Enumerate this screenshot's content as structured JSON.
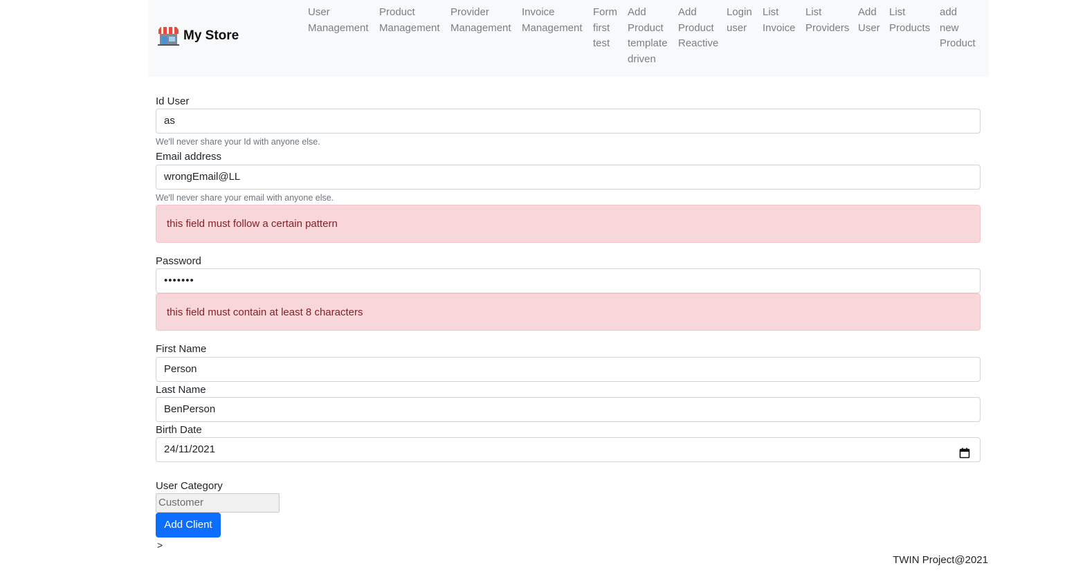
{
  "navbar": {
    "brand": "My Store",
    "brand_icon": "store-icon",
    "links": [
      {
        "id": "user-management",
        "lines": [
          "User",
          "Management"
        ]
      },
      {
        "id": "product-management",
        "lines": [
          "Product",
          "Management"
        ]
      },
      {
        "id": "provider-management",
        "lines": [
          "Provider",
          "Management"
        ]
      },
      {
        "id": "invoice-management",
        "lines": [
          "Invoice",
          "Management"
        ]
      },
      {
        "id": "form-first-test",
        "lines": [
          "Form",
          "first",
          "test"
        ]
      },
      {
        "id": "add-product-template-driven",
        "lines": [
          "Add",
          "Product",
          "template",
          "driven"
        ]
      },
      {
        "id": "add-product-reactive",
        "lines": [
          "Add",
          "Product",
          "Reactive"
        ]
      },
      {
        "id": "login-user",
        "lines": [
          "Login",
          "user"
        ]
      },
      {
        "id": "list-invoice",
        "lines": [
          "List",
          "Invoice"
        ]
      },
      {
        "id": "list-providers",
        "lines": [
          "List",
          "Providers"
        ]
      },
      {
        "id": "add-user",
        "lines": [
          "Add",
          "User"
        ]
      },
      {
        "id": "list-products",
        "lines": [
          "List",
          "Products"
        ]
      },
      {
        "id": "add-new-product",
        "lines": [
          "add",
          "new",
          "Product"
        ]
      }
    ]
  },
  "form": {
    "id_user": {
      "label": "Id User",
      "value": "as",
      "help": "We'll never share your Id with anyone else."
    },
    "email": {
      "label": "Email address",
      "value": "wrongEmail@LL",
      "help": "We'll never share your email with anyone else.",
      "error": "this field must follow a certain pattern"
    },
    "password": {
      "label": "Password",
      "value": "•••••••",
      "error": "this field must contain at least 8 characters"
    },
    "first_name": {
      "label": "First Name",
      "value": "Person"
    },
    "last_name": {
      "label": "Last Name",
      "value": "BenPerson"
    },
    "birth_date": {
      "label": "Birth Date",
      "value": "24/11/2021",
      "icon": "calendar-icon"
    },
    "user_category": {
      "label": "User Category",
      "value": "Customer"
    },
    "submit_label": "Add Client",
    "trailing_text": ">"
  },
  "footer": {
    "text": "TWIN Project@2021"
  },
  "colors": {
    "primary": "#0d6efd",
    "alert_bg": "#f8d7da",
    "alert_text": "#842029",
    "navbar_bg": "#f8f9fa"
  }
}
